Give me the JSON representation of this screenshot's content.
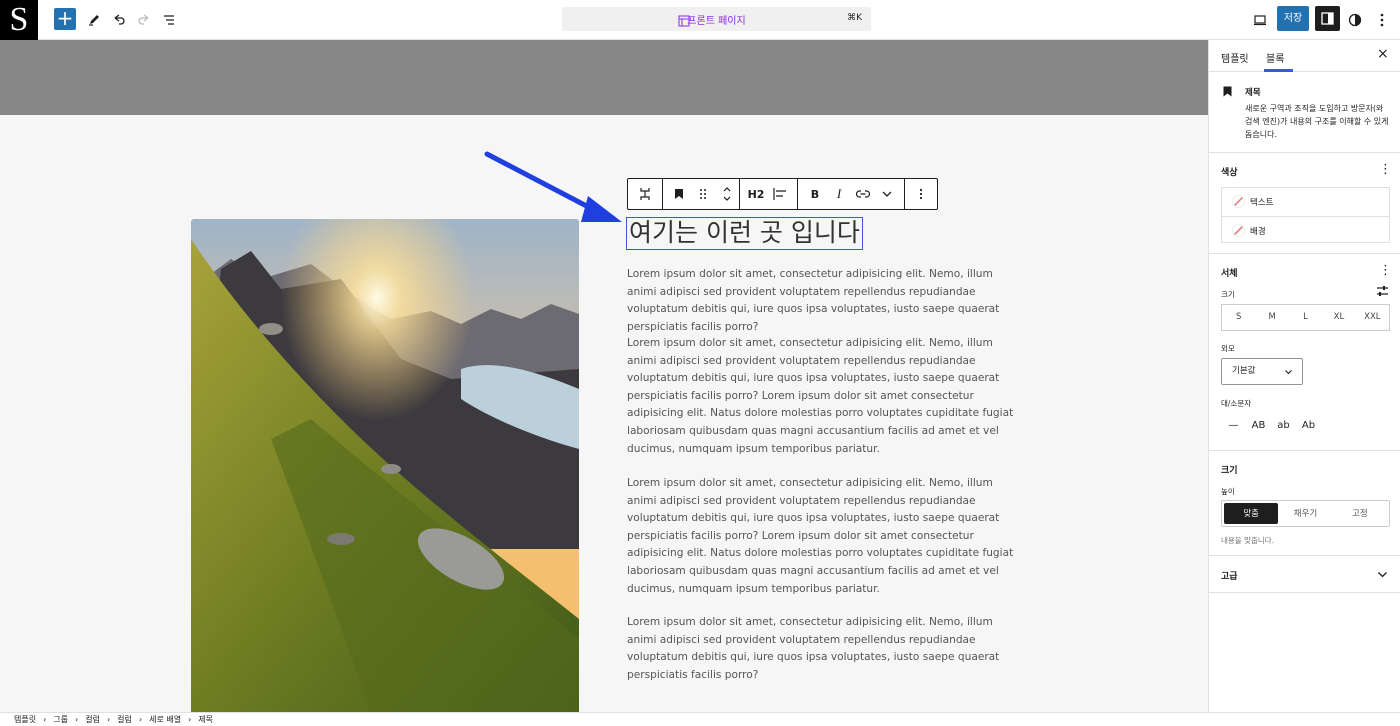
{
  "topbar": {
    "logo": "S",
    "add_label": "+",
    "doc_title": "프론트 페이지",
    "shortcut": "⌘K",
    "save_label": "저장"
  },
  "canvas": {
    "heading": "여기는 이런 곳 입니다",
    "paragraphs": [
      "Lorem ipsum dolor sit amet, consectetur adipisicing elit. Nemo, illum animi adipisci sed provident voluptatem repellendus repudiandae voluptatum debitis qui, iure quos ipsa voluptates, iusto saepe quaerat perspiciatis facilis porro?",
      "Lorem ipsum dolor sit amet, consectetur adipisicing elit. Nemo, illum animi adipisci sed provident voluptatem repellendus repudiandae voluptatum debitis qui, iure quos ipsa voluptates, iusto saepe quaerat perspiciatis facilis porro? Lorem ipsum dolor sit amet consectetur adipisicing elit. Natus dolore molestias porro voluptates cupiditate fugiat laboriosam quibusdam quas magni accusantium facilis ad amet et vel ducimus, numquam ipsum temporibus pariatur.",
      "Lorem ipsum dolor sit amet, consectetur adipisicing elit. Nemo, illum animi adipisci sed provident voluptatem repellendus repudiandae voluptatum debitis qui, iure quos ipsa voluptates, iusto saepe quaerat perspiciatis facilis porro? Lorem ipsum dolor sit amet consectetur adipisicing elit. Natus dolore molestias porro voluptates cupiditate fugiat laboriosam quibusdam quas magni accusantium facilis ad amet et vel ducimus, numquam ipsum temporibus pariatur.",
      "Lorem ipsum dolor sit amet, consectetur adipisicing elit. Nemo, illum animi adipisci sed provident voluptatem repellendus repudiandae voluptatum debitis qui, iure quos ipsa voluptates, iusto saepe quaerat perspiciatis facilis porro?"
    ],
    "toolbar": {
      "heading_level": "H2",
      "bold": "B",
      "italic": "I"
    }
  },
  "sidebar": {
    "tabs": [
      "템플릿",
      "블록"
    ],
    "close": "×",
    "block_name": "제목",
    "block_description": "새로운 구역과 조직을 도입하고 방문자(와 검색 엔진)가 내용의 구조를 이해할 수 있게 돕습니다.",
    "color": {
      "heading": "색상",
      "items": [
        "텍스트",
        "배경"
      ]
    },
    "typography": {
      "heading": "서체",
      "size_label": "크기",
      "sizes": [
        "S",
        "M",
        "L",
        "XL",
        "XXL"
      ],
      "appearance_label": "외모",
      "appearance_value": "기본값",
      "case_label": "대/소문자",
      "case_options": [
        "—",
        "AB",
        "ab",
        "Ab"
      ]
    },
    "dimensions": {
      "heading": "크기",
      "height_label": "높이",
      "options": [
        "맞춤",
        "채우기",
        "고정"
      ],
      "selected": "맞춤",
      "help": "내용을 맞춥니다."
    },
    "advanced": {
      "heading": "고급"
    }
  },
  "breadcrumb": [
    "템플릿",
    "그룹",
    "컬럼",
    "컬럼",
    "세로 배열",
    "제목"
  ],
  "colors": {
    "accent": "#2271b1",
    "selection": "#3858e9",
    "arrow": "#1f3fe0",
    "doc_title": "#8a2be2"
  }
}
